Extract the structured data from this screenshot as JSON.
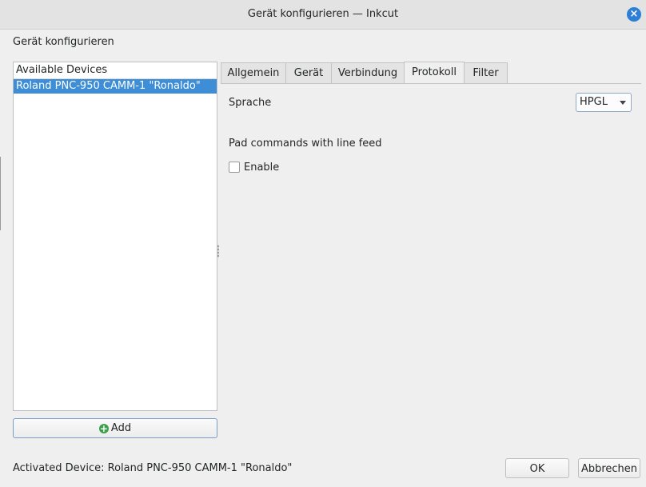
{
  "window": {
    "title": "Gerät konfigurieren — Inkcut"
  },
  "dialog": {
    "heading": "Gerät konfigurieren"
  },
  "devices": {
    "header": "Available Devices",
    "items": [
      {
        "label": "Roland PNC-950 CAMM-1 \"Ronaldo\"",
        "selected": true
      }
    ],
    "add_label": "Add"
  },
  "tabs": [
    {
      "label": "Allgemein",
      "active": false
    },
    {
      "label": "Gerät",
      "active": false
    },
    {
      "label": "Verbindung",
      "active": false
    },
    {
      "label": "Protokoll",
      "active": true
    },
    {
      "label": "Filter",
      "active": false
    }
  ],
  "protocol": {
    "language_label": "Sprache",
    "language_value": "HPGL",
    "pad_label": "Pad commands with line feed",
    "enable_label": "Enable",
    "enable_checked": false
  },
  "footer": {
    "status": "Activated Device: Roland PNC-950 CAMM-1 \"Ronaldo\"",
    "ok_label": "OK",
    "cancel_label": "Abbrechen"
  },
  "colors": {
    "selection": "#3d8ed6",
    "close_button": "#2c7ed6",
    "add_icon": "#3aa14a"
  }
}
